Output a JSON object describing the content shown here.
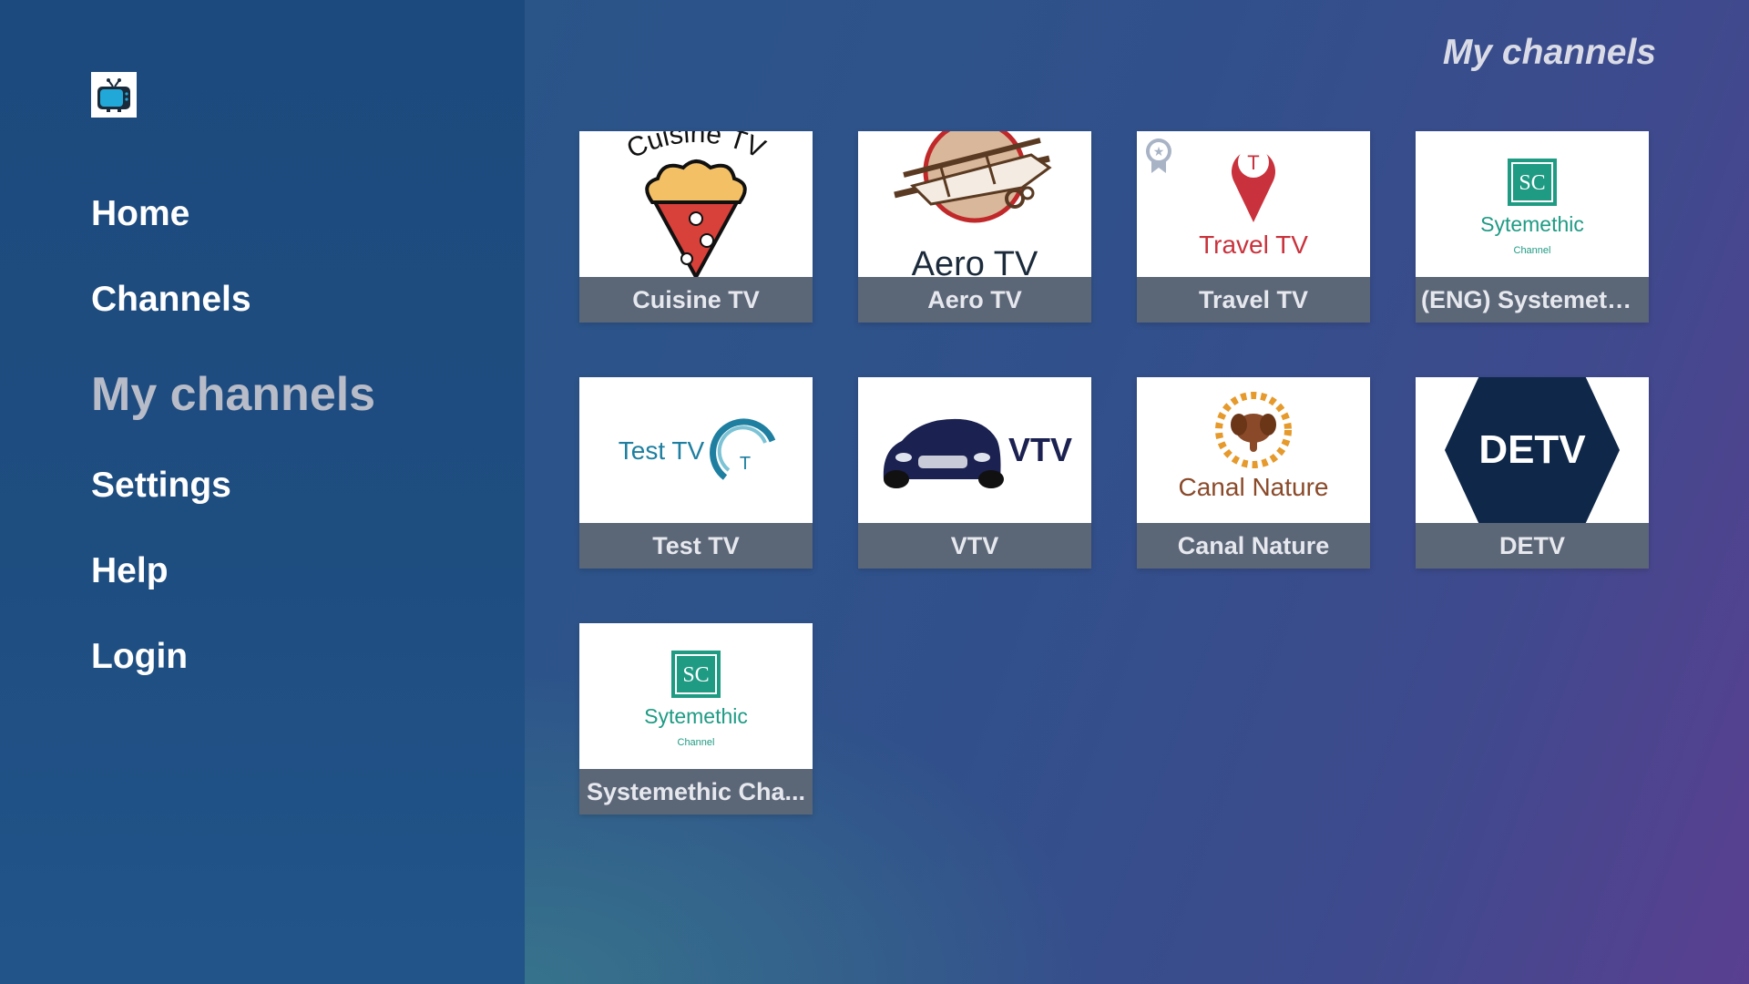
{
  "app": {
    "logo_icon": "tv-icon"
  },
  "nav": {
    "items": [
      {
        "label": "Home",
        "active": false
      },
      {
        "label": "Channels",
        "active": false
      },
      {
        "label": "My channels",
        "active": true
      },
      {
        "label": "Settings",
        "active": false
      },
      {
        "label": "Help",
        "active": false
      },
      {
        "label": "Login",
        "active": false
      }
    ]
  },
  "header": {
    "title": "My channels"
  },
  "channels": [
    {
      "name": "Cuisine TV",
      "logo_text": "Cuisine TV",
      "icon": "ice-cream-cone-icon"
    },
    {
      "name": "Aero TV",
      "logo_text": "Aero TV",
      "icon": "biplane-icon"
    },
    {
      "name": "Travel TV",
      "logo_text": "Travel TV",
      "icon": "map-pin-icon",
      "pin_letter": "T",
      "badge_icon": "award-ribbon-icon"
    },
    {
      "name": "(ENG) Systemethi...",
      "logo_text": "Sytemethic",
      "logo_sub": "Channel",
      "logo_mark": "SC",
      "icon": "sc-square-icon"
    },
    {
      "name": "Test TV",
      "logo_text": "Test TV",
      "logo_mark": "T",
      "icon": "swirl-icon"
    },
    {
      "name": "VTV",
      "logo_text": "VTV",
      "icon": "car-icon"
    },
    {
      "name": "Canal Nature",
      "logo_text": "Canal Nature",
      "icon": "elephant-icon"
    },
    {
      "name": "DETV",
      "logo_text": "DETV",
      "icon": "hexagon-icon"
    },
    {
      "name": "Systemethic Cha...",
      "logo_text": "Sytemethic",
      "logo_sub": "Channel",
      "logo_mark": "SC",
      "icon": "sc-square-icon"
    }
  ],
  "colors": {
    "sidebar": "#1e4d80",
    "card_label_bg": "#5b6677",
    "active_nav": "#b8bcc8",
    "cuisine_red": "#d8403a",
    "travel_red": "#c9323c",
    "sytemethic_green": "#1f9b84",
    "test_tv_blue": "#1e7fa0",
    "vtv_navy": "#1b2150",
    "nature_brown": "#8a4a2a",
    "detv_navy": "#0f2749"
  }
}
